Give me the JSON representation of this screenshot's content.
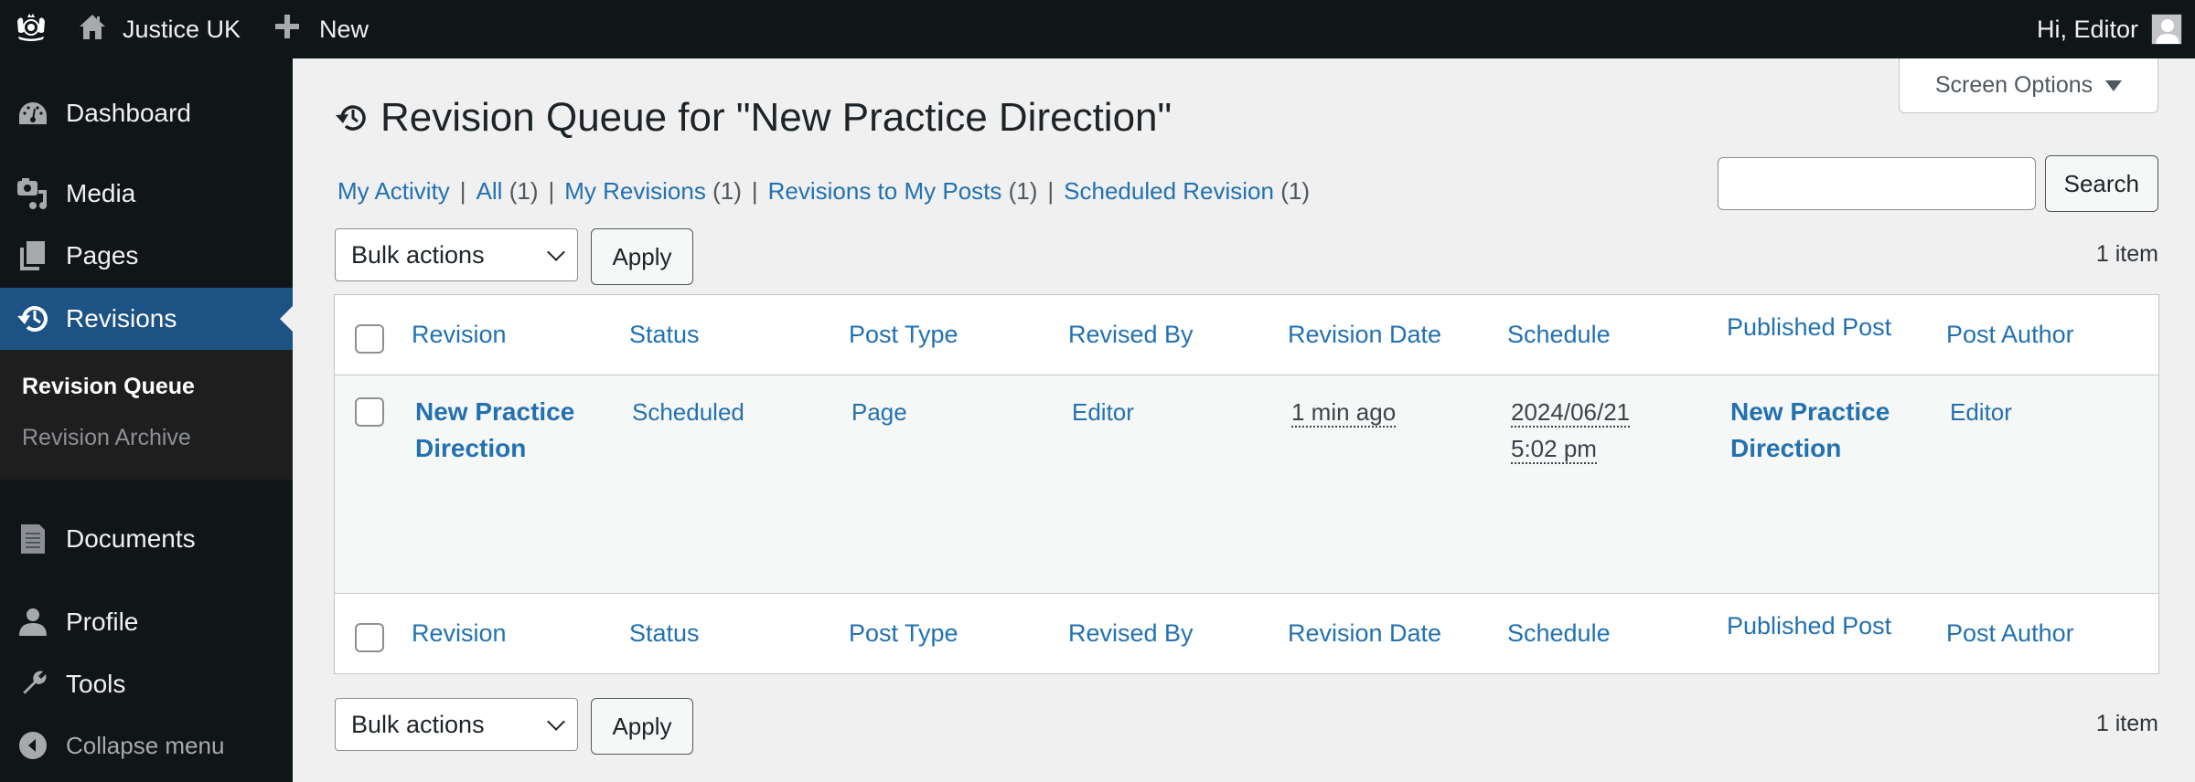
{
  "adminbar": {
    "logo_icon": "royal-coat-of-arms-icon",
    "site_name": "Justice UK",
    "site_icon": "home-icon",
    "new_label": "New",
    "new_icon": "plus-icon",
    "greeting": "Hi, Editor",
    "avatar_icon": "user-avatar-icon"
  },
  "sidebar": {
    "items": [
      {
        "label": "Dashboard",
        "icon": "dashboard-icon"
      },
      {
        "label": "Media",
        "icon": "media-icon"
      },
      {
        "label": "Pages",
        "icon": "pages-icon"
      },
      {
        "label": "Revisions",
        "icon": "history-icon",
        "active": true
      },
      {
        "label": "Documents",
        "icon": "document-icon"
      },
      {
        "label": "Profile",
        "icon": "user-icon"
      },
      {
        "label": "Tools",
        "icon": "wrench-icon"
      },
      {
        "label": "Collapse menu",
        "icon": "collapse-arrow-icon"
      }
    ],
    "submenu": [
      {
        "label": "Revision Queue",
        "current": true
      },
      {
        "label": "Revision Archive",
        "current": false
      }
    ]
  },
  "screen_options": {
    "label": "Screen Options"
  },
  "page": {
    "title": "Revision Queue for \"New Practice Direction\"",
    "title_icon": "history-icon"
  },
  "filters": [
    {
      "label": "My Activity",
      "count": ""
    },
    {
      "label": "All",
      "count": "(1)"
    },
    {
      "label": "My Revisions",
      "count": "(1)"
    },
    {
      "label": "Revisions to My Posts",
      "count": "(1)"
    },
    {
      "label": "Scheduled Revision",
      "count": "(1)"
    }
  ],
  "filter_separator": "|",
  "search": {
    "value": "",
    "placeholder": "",
    "button_label": "Search"
  },
  "tablenav": {
    "bulk_actions_selected": "Bulk actions",
    "apply_label": "Apply",
    "item_count": "1 item"
  },
  "table": {
    "columns": [
      "Revision",
      "Status",
      "Post Type",
      "Revised By",
      "Revision Date",
      "Schedule",
      "Published Post",
      "Post Author"
    ],
    "rows": [
      {
        "revision": "New Practice Direction",
        "status": "Scheduled",
        "post_type": "Page",
        "revised_by": "Editor",
        "revision_date": "1 min ago",
        "schedule_date": "2024/06/21",
        "schedule_time": "5:02 pm",
        "published_post": "New Practice Direction",
        "post_author": "Editor"
      }
    ]
  },
  "colors": {
    "adminbar_bg": "#101517",
    "sidebar_active": "#1d5285",
    "link": "#2271b1",
    "content_bg": "#f0f0f1"
  }
}
